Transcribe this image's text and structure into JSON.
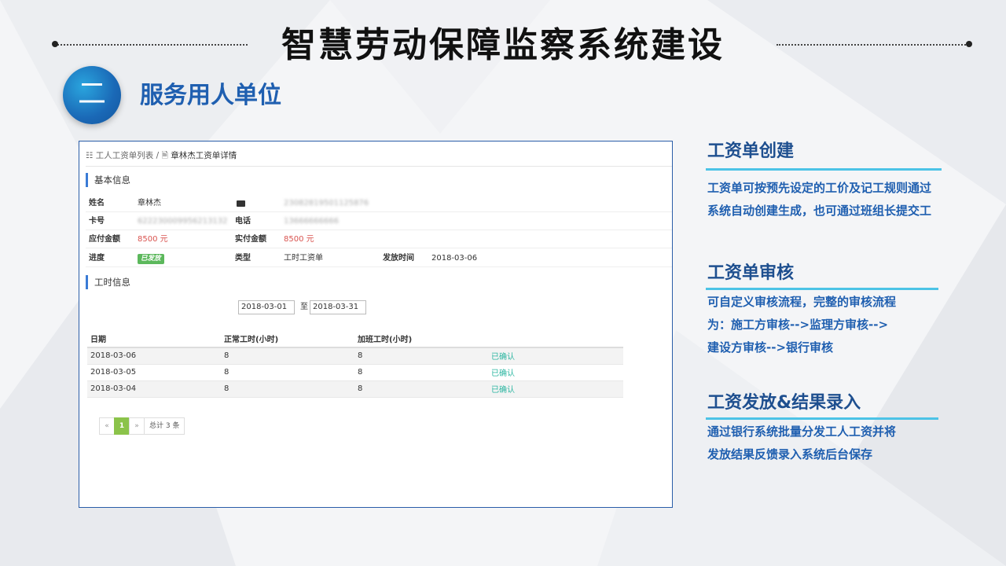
{
  "header": {
    "title": "智慧劳动保障监察系统建设",
    "section_number": "二",
    "section_title": "服务用人单位"
  },
  "breadcrumb": {
    "list_label": "工人工资单列表",
    "separator": "/",
    "current_label": "章林杰工资单详情"
  },
  "basic_info": {
    "heading": "基本信息",
    "name_label": "姓名",
    "name_value": "章林杰",
    "id_value": "23082819501125876",
    "card_label": "卡号",
    "card_value": "622230009956213132",
    "phone_label": "电话",
    "phone_value": "13666666666",
    "payable_label": "应付金额",
    "payable_value": "8500 元",
    "paid_label": "实付金额",
    "paid_value": "8500 元",
    "progress_label": "进度",
    "progress_value": "已发放",
    "type_label": "类型",
    "type_value": "工时工资单",
    "issue_time_label": "发放时间",
    "issue_time_value": "2018-03-06"
  },
  "work_hours": {
    "heading": "工时信息",
    "date_from": "2018-03-01",
    "date_sep": "至",
    "date_to": "2018-03-31",
    "columns": [
      "日期",
      "正常工时(小时)",
      "加班工时(小时)",
      ""
    ],
    "rows": [
      {
        "date": "2018-03-06",
        "normal": "8",
        "overtime": "8",
        "status": "已确认"
      },
      {
        "date": "2018-03-05",
        "normal": "8",
        "overtime": "8",
        "status": "已确认"
      },
      {
        "date": "2018-03-04",
        "normal": "8",
        "overtime": "8",
        "status": "已确认"
      }
    ]
  },
  "pagination": {
    "prev": "«",
    "current": "1",
    "next": "»",
    "total": "总计 3 条"
  },
  "features": [
    {
      "title": "工资单创建",
      "lines": [
        "工资单可按预先设定的工价及记工规则通过",
        "系统自动创建生成，也可通过班组长提交工"
      ]
    },
    {
      "title": "工资单审核",
      "lines": [
        "可自定义审核流程，完整的审核流程",
        "为：施工方审核-->监理方审核-->",
        "建设方审核-->银行审核"
      ]
    },
    {
      "title": "工资发放&结果录入",
      "lines": [
        "通过银行系统批量分发工人工资并将",
        "发放结果反馈录入系统后台保存"
      ]
    }
  ],
  "colors": {
    "accent_blue": "#1f5fb0",
    "feature_bar": "#4cc3e6",
    "panel_border": "#2a5da8",
    "confirmed_green": "#2ab5a0",
    "badge_green": "#5cb85c",
    "amount_red": "#d9534f"
  }
}
